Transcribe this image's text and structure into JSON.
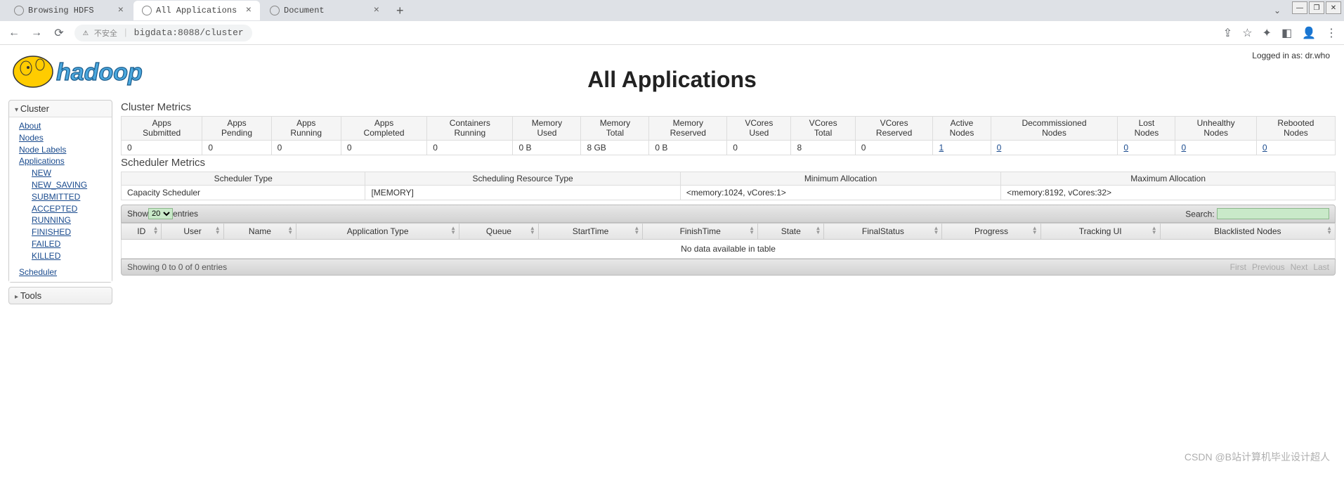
{
  "browser": {
    "tabs": [
      {
        "title": "Browsing HDFS",
        "active": false
      },
      {
        "title": "All Applications",
        "active": true
      },
      {
        "title": "Document",
        "active": false
      }
    ],
    "url": "bigdata:8088/cluster",
    "insecure_label": "不安全"
  },
  "header": {
    "title": "All Applications",
    "login_prefix": "Logged in as: ",
    "login_user": "dr.who"
  },
  "sidebar": {
    "cluster": {
      "label": "Cluster",
      "about": "About",
      "nodes": "Nodes",
      "node_labels": "Node Labels",
      "applications": "Applications",
      "app_states": [
        "NEW",
        "NEW_SAVING",
        "SUBMITTED",
        "ACCEPTED",
        "RUNNING",
        "FINISHED",
        "FAILED",
        "KILLED"
      ],
      "scheduler": "Scheduler"
    },
    "tools": {
      "label": "Tools"
    }
  },
  "cluster_metrics": {
    "title": "Cluster Metrics",
    "headers": [
      "Apps Submitted",
      "Apps Pending",
      "Apps Running",
      "Apps Completed",
      "Containers Running",
      "Memory Used",
      "Memory Total",
      "Memory Reserved",
      "VCores Used",
      "VCores Total",
      "VCores Reserved",
      "Active Nodes",
      "Decommissioned Nodes",
      "Lost Nodes",
      "Unhealthy Nodes",
      "Rebooted Nodes"
    ],
    "values": [
      "0",
      "0",
      "0",
      "0",
      "0",
      "0 B",
      "8 GB",
      "0 B",
      "0",
      "8",
      "0",
      "1",
      "0",
      "0",
      "0",
      "0"
    ],
    "linked_cols": [
      11,
      12,
      13,
      14,
      15
    ]
  },
  "scheduler_metrics": {
    "title": "Scheduler Metrics",
    "headers": [
      "Scheduler Type",
      "Scheduling Resource Type",
      "Minimum Allocation",
      "Maximum Allocation"
    ],
    "values": [
      "Capacity Scheduler",
      "[MEMORY]",
      "<memory:1024, vCores:1>",
      "<memory:8192, vCores:32>"
    ]
  },
  "datatable": {
    "show_prefix": "Show ",
    "show_value": "20",
    "show_suffix": " entries",
    "search_label": "Search:",
    "columns": [
      "ID",
      "User",
      "Name",
      "Application Type",
      "Queue",
      "StartTime",
      "FinishTime",
      "State",
      "FinalStatus",
      "Progress",
      "Tracking UI",
      "Blacklisted Nodes"
    ],
    "no_data": "No data available in table",
    "info": "Showing 0 to 0 of 0 entries",
    "pager": [
      "First",
      "Previous",
      "Next",
      "Last"
    ]
  },
  "watermark": "CSDN @B站计算机毕业设计超人"
}
